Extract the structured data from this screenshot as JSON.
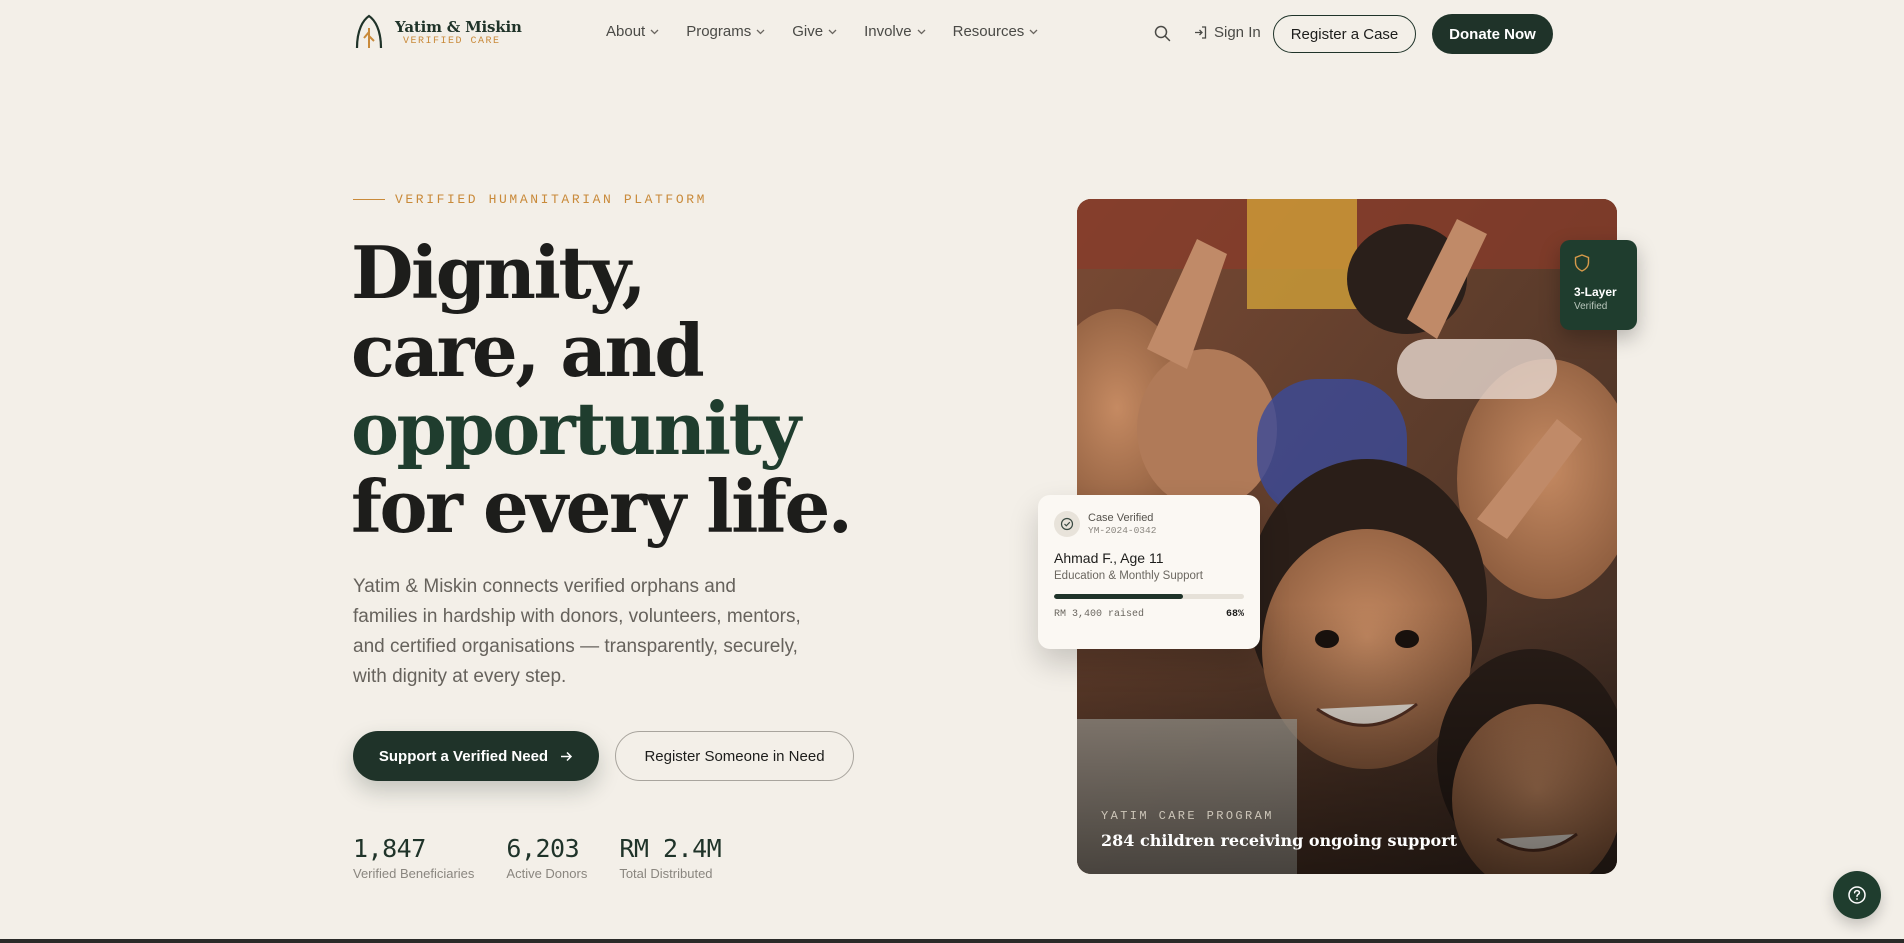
{
  "brand": {
    "name": "Yatim & Miskin",
    "tagline": "VERIFIED CARE"
  },
  "nav": {
    "items": [
      {
        "label": "About"
      },
      {
        "label": "Programs"
      },
      {
        "label": "Give"
      },
      {
        "label": "Involve"
      },
      {
        "label": "Resources"
      }
    ],
    "signin_label": "Sign In",
    "register_label": "Register a Case",
    "donate_label": "Donate Now"
  },
  "hero": {
    "eyebrow": "VERIFIED HUMANITARIAN PLATFORM",
    "headline_line1": "Dignity,",
    "headline_line2": "care, and",
    "headline_line3": "opportunity",
    "headline_line4": "for every life.",
    "lead": "Yatim & Miskin connects verified orphans and families in hardship with donors, volunteers, mentors, and certified organisations — transparently, securely, with dignity at every step.",
    "primary_cta": "Support a Verified Need",
    "secondary_cta": "Register Someone in Need",
    "stats": [
      {
        "value": "1,847",
        "label": "Verified Beneficiaries"
      },
      {
        "value": "6,203",
        "label": "Active Donors"
      },
      {
        "value": "RM 2.4M",
        "label": "Total Distributed"
      }
    ]
  },
  "photo": {
    "kicker": "YATIM CARE PROGRAM",
    "title": "284 children receiving ongoing support"
  },
  "badge": {
    "title": "3-Layer",
    "subtitle": "Verified"
  },
  "case_card": {
    "status": "Case Verified",
    "case_id": "YM-2024-0342",
    "name": "Ahmad F., Age 11",
    "program": "Education & Monthly Support",
    "raised": "RM 3,400 raised",
    "progress_pct": "68%",
    "progress": 0.68
  },
  "colors": {
    "background": "#f3efe8",
    "primary": "#1f3329",
    "accent": "#c98a3a",
    "text": "#1d1d1b"
  },
  "icons": [
    "search-icon",
    "sign-in-icon",
    "arrow-right-icon",
    "shield-icon",
    "check-circle-icon",
    "help-icon",
    "chevron-down-icon"
  ]
}
